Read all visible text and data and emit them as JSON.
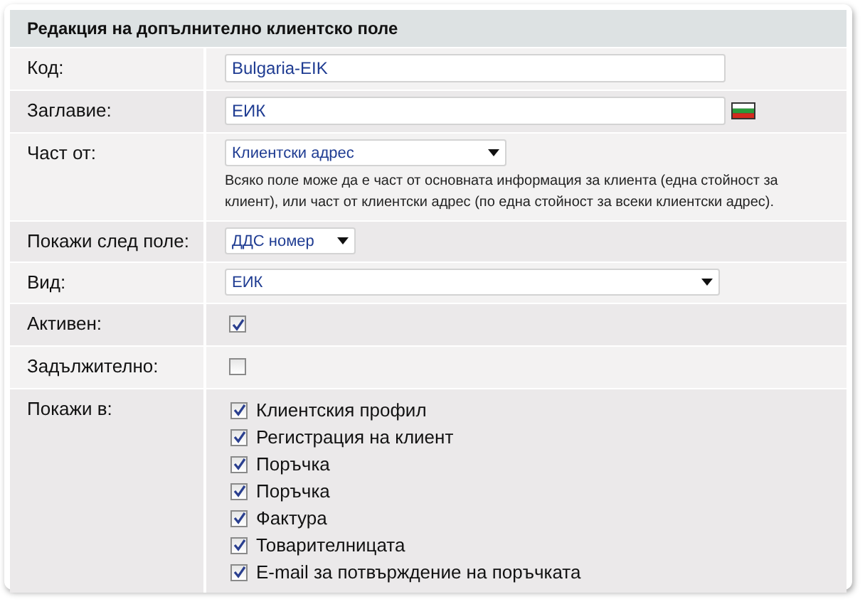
{
  "title": "Редакция на допълнително клиентско поле",
  "rows": [
    {
      "label": "Код:",
      "kind": "text",
      "value": "Bulgaria-EIK"
    },
    {
      "label": "Заглавие:",
      "kind": "text-flag",
      "value": "ЕИК"
    },
    {
      "label": "Част от:",
      "kind": "select",
      "value": "Клиентски адрес",
      "hint": "Всяко поле може да е част от основната информация за клиента (една стойност за клиент), или част от клиентски адрес (по една стойност за всеки клиентски адрес)."
    },
    {
      "label": "Покажи след поле:",
      "kind": "select-small",
      "value": "ДДС номер"
    },
    {
      "label": "Вид:",
      "kind": "select-wide",
      "value": "ЕИК"
    },
    {
      "label": "Активен:",
      "kind": "checkbox",
      "checked": true
    },
    {
      "label": "Задължително:",
      "kind": "checkbox",
      "checked": false
    },
    {
      "label": "Покажи в:",
      "kind": "checklist",
      "options": [
        {
          "label": "Клиентския профил",
          "checked": true
        },
        {
          "label": "Регистрация на клиент",
          "checked": true
        },
        {
          "label": "Поръчка",
          "checked": true
        },
        {
          "label": "Поръчка",
          "checked": true
        },
        {
          "label": "Фактура",
          "checked": true
        },
        {
          "label": "Товарителницата",
          "checked": true
        },
        {
          "label": "E-mail за потвърждение на поръчката",
          "checked": true
        }
      ]
    }
  ]
}
